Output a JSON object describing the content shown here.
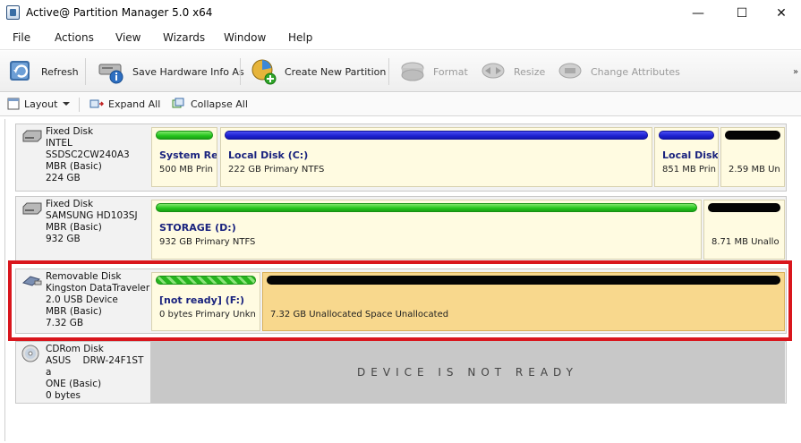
{
  "window": {
    "title": "Active@ Partition Manager 5.0 x64",
    "minimize": "—",
    "maximize": "☐",
    "close": "✕"
  },
  "menu": [
    "File",
    "Actions",
    "View",
    "Wizards",
    "Window",
    "Help"
  ],
  "toolbar": {
    "refresh": "Refresh",
    "save_hw": "Save Hardware Info As",
    "create": "Create New Partition",
    "format": "Format",
    "resize": "Resize",
    "change_attr": "Change Attributes",
    "more": "»"
  },
  "subbar": {
    "layout": "Layout",
    "expand": "Expand All",
    "collapse": "Collapse All"
  },
  "disks": [
    {
      "lines": [
        "Fixed Disk",
        "INTEL",
        "SSDSC2CW240A3",
        "MBR (Basic)",
        "224 GB"
      ],
      "partitions": [
        {
          "name": "System Re",
          "desc": "500 MB Prin",
          "bar": "green"
        },
        {
          "name": "Local Disk (C:)",
          "desc": "222 GB Primary NTFS",
          "bar": "blue"
        },
        {
          "name": "Local Disk (",
          "desc": "851 MB Prin",
          "bar": "blue"
        },
        {
          "name": "",
          "desc": "2.59 MB Un",
          "bar": "black"
        }
      ]
    },
    {
      "lines": [
        "Fixed Disk",
        "SAMSUNG HD103SJ",
        "MBR (Basic)",
        "932 GB"
      ],
      "partitions": [
        {
          "name": "STORAGE (D:)",
          "desc": "932 GB Primary NTFS",
          "bar": "green"
        },
        {
          "name": "",
          "desc": "8.71 MB Unallo",
          "bar": "black"
        }
      ]
    },
    {
      "lines": [
        "Removable Disk",
        "Kingston DataTraveler",
        "2.0 USB Device",
        "MBR (Basic)",
        "7.32 GB"
      ],
      "partitions": [
        {
          "name": "[not ready] (F:)",
          "desc": "0 bytes Primary Unkn",
          "bar": "hatch"
        },
        {
          "name": "",
          "desc": "7.32 GB Unallocated Space Unallocated",
          "bar": "black"
        }
      ]
    },
    {
      "lines": [
        "CDRom Disk",
        "ASUS    DRW-24F1ST",
        "a",
        "ONE (Basic)",
        "0 bytes"
      ],
      "status": "DEVICE IS NOT READY"
    }
  ],
  "colors": {
    "highlight": "#d9161d",
    "partition_bg": "#fffbe1",
    "unallocated_bg": "#f8d88d",
    "name_text": "#1a237e"
  }
}
